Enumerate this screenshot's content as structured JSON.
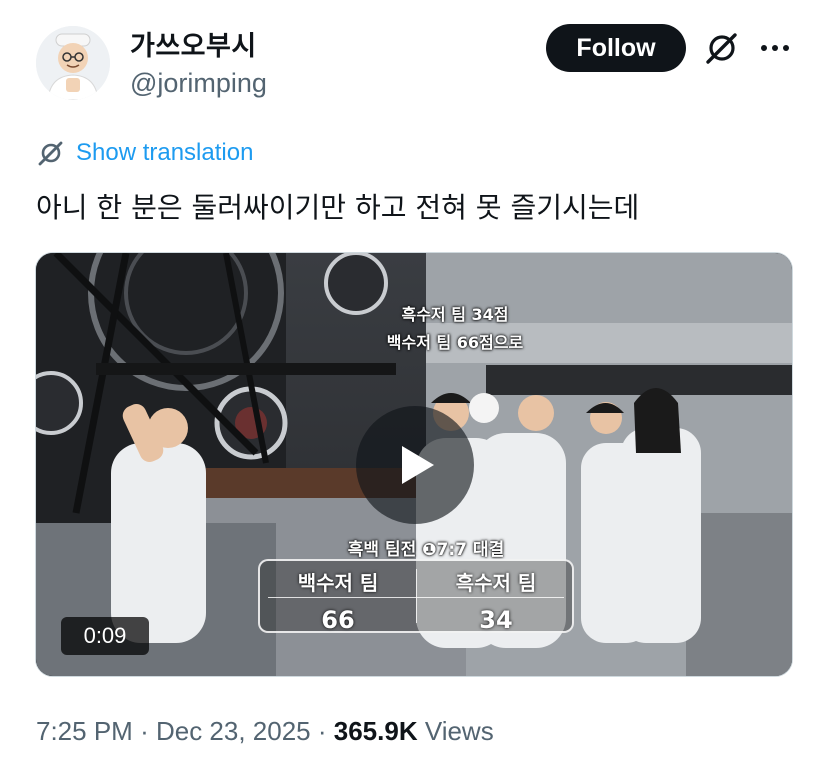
{
  "author": {
    "display_name": "가쓰오부시",
    "handle": "@jorimping",
    "avatar_icon": "chef-avatar-icon"
  },
  "header": {
    "follow_label": "Follow",
    "more_icon": "more-dots-icon",
    "grok_icon": "grok-icon"
  },
  "tweet": {
    "translate_label": "Show translation",
    "text": "아니 한 분은 둘러싸이기만 하고 전혀 못 즐기시는데"
  },
  "media": {
    "caption_line1": "흑수저 팀 34점",
    "caption_line2": "백수저 팀 66점으로",
    "scoreboard": {
      "title": "흑백 팀전 ❶7:7 대결",
      "left_team": "백수저 팀",
      "left_score": "66",
      "right_team": "흑수저 팀",
      "right_score": "34"
    },
    "duration": "0:09",
    "play_icon": "play-icon"
  },
  "meta": {
    "time": "7:25 PM",
    "date": "Dec 23, 2025",
    "views_count": "365.9K",
    "views_label": "Views"
  },
  "colors": {
    "accent": "#1d9bf0",
    "text_primary": "#0f1419",
    "text_secondary": "#536471",
    "follow_bg": "#0f1419"
  }
}
